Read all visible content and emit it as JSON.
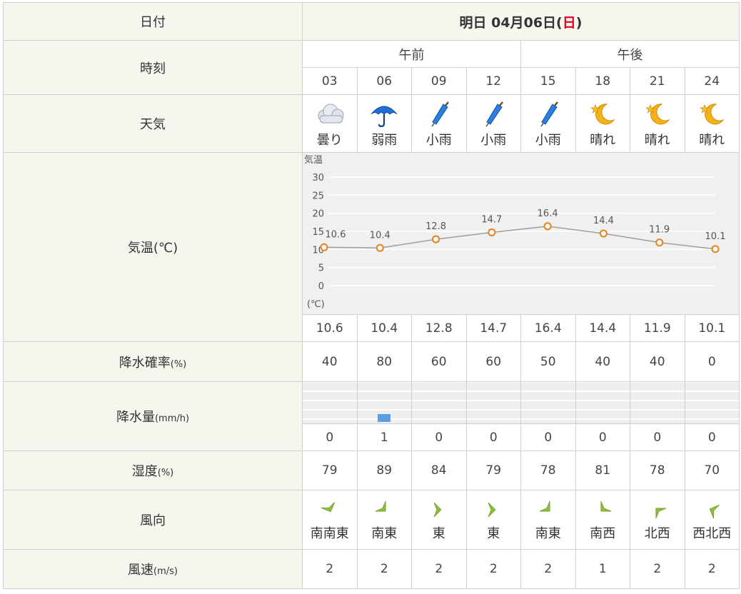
{
  "labels": {
    "date": "日付",
    "time": "時刻",
    "weather": "天気",
    "temperature": "気温(℃)",
    "precip_prob": "降水確率",
    "precip_prob_unit": "(%)",
    "precip_amount": "降水量",
    "precip_amount_unit": "(mm/h)",
    "humidity": "湿度",
    "humidity_unit": "(%)",
    "wind_dir": "風向",
    "wind_speed": "風速",
    "wind_speed_unit": "(m/s)"
  },
  "date_header": {
    "prefix": "明日 04月06日(",
    "weekday": "日",
    "suffix": ")"
  },
  "periods": {
    "am": "午前",
    "pm": "午後"
  },
  "hours": [
    "03",
    "06",
    "09",
    "12",
    "15",
    "18",
    "21",
    "24"
  ],
  "weather": [
    {
      "label": "曇り",
      "icon": "cloud-icon"
    },
    {
      "label": "弱雨",
      "icon": "umbrella-icon"
    },
    {
      "label": "小雨",
      "icon": "folded-umbrella-icon"
    },
    {
      "label": "小雨",
      "icon": "folded-umbrella-icon"
    },
    {
      "label": "小雨",
      "icon": "folded-umbrella-icon"
    },
    {
      "label": "晴れ",
      "icon": "moon-star-icon"
    },
    {
      "label": "晴れ",
      "icon": "moon-star-icon"
    },
    {
      "label": "晴れ",
      "icon": "moon-star-icon"
    }
  ],
  "temperatures": [
    "10.6",
    "10.4",
    "12.8",
    "14.7",
    "16.4",
    "14.4",
    "11.9",
    "10.1"
  ],
  "precip_prob": [
    "40",
    "80",
    "60",
    "60",
    "50",
    "40",
    "40",
    "0"
  ],
  "precip_amount": [
    "0",
    "1",
    "0",
    "0",
    "0",
    "0",
    "0",
    "0"
  ],
  "humidity": [
    "79",
    "89",
    "84",
    "79",
    "78",
    "81",
    "78",
    "70"
  ],
  "wind": [
    {
      "dir": "南南東",
      "deg": 157.5
    },
    {
      "dir": "南東",
      "deg": 135
    },
    {
      "dir": "東",
      "deg": 90
    },
    {
      "dir": "東",
      "deg": 90
    },
    {
      "dir": "南東",
      "deg": 135
    },
    {
      "dir": "南西",
      "deg": 225
    },
    {
      "dir": "北西",
      "deg": 315
    },
    {
      "dir": "西北西",
      "deg": 292.5
    }
  ],
  "wind_speed": [
    "2",
    "2",
    "2",
    "2",
    "2",
    "1",
    "2",
    "2"
  ],
  "colors": {
    "header_bg": "#f6f6ef",
    "sunday_red": "#e8001b",
    "line": "#999999",
    "marker": "#e8862a",
    "rain_bar": "#5f9be2",
    "wind_arrow": "#8dbf3a"
  },
  "chart_data": {
    "type": "line",
    "title": "",
    "ylabel": "気温",
    "yunit": "(℃)",
    "x": [
      "03",
      "06",
      "09",
      "12",
      "15",
      "18",
      "21",
      "24"
    ],
    "series": [
      {
        "values": [
          10.6,
          10.4,
          12.8,
          14.7,
          16.4,
          14.4,
          11.9,
          10.1
        ]
      }
    ],
    "yticks": [
      "0",
      "5",
      "10",
      "15",
      "20",
      "25",
      "30"
    ],
    "ylim": [
      -5,
      35
    ],
    "data_labels": [
      "10.6",
      "10.4",
      "12.8",
      "14.7",
      "16.4",
      "14.4",
      "11.9",
      "10.1"
    ],
    "grid": true,
    "legend": "none"
  }
}
